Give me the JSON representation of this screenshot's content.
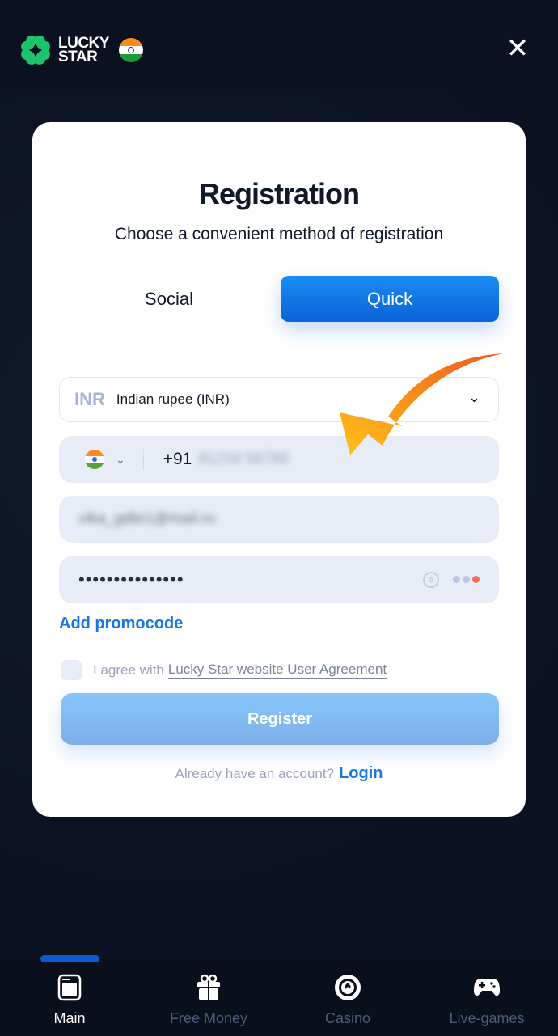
{
  "header": {
    "logo_line1": "LUCKY",
    "logo_line2": "STAR",
    "close_icon": "close-icon"
  },
  "modal": {
    "title": "Registration",
    "subtitle": "Choose a convenient method of registration",
    "tabs": [
      {
        "label": "Social",
        "active": false
      },
      {
        "label": "Quick",
        "active": true
      }
    ],
    "currency": {
      "code": "INR",
      "name": "Indian rupee (INR)"
    },
    "phone": {
      "prefix": "+91",
      "value": "81234 56789"
    },
    "email": {
      "value": "vika_gdbr1@mail.ru"
    },
    "password": {
      "value": "•••••••••••••••"
    },
    "promocode_label": "Add promocode",
    "agreement": {
      "text": "I agree with",
      "link": "Lucky Star website User Agreement",
      "checked": false
    },
    "register_label": "Register",
    "already_text": "Already have an account?",
    "login_label": "Login",
    "accent_color": "#1877e8"
  },
  "nav": {
    "items": [
      {
        "label": "Main",
        "icon": "main-icon",
        "active": true
      },
      {
        "label": "Free Money",
        "icon": "gift-icon"
      },
      {
        "label": "Casino",
        "icon": "casino-chip-icon"
      },
      {
        "label": "Live-games",
        "icon": "gamepad-icon"
      }
    ]
  }
}
